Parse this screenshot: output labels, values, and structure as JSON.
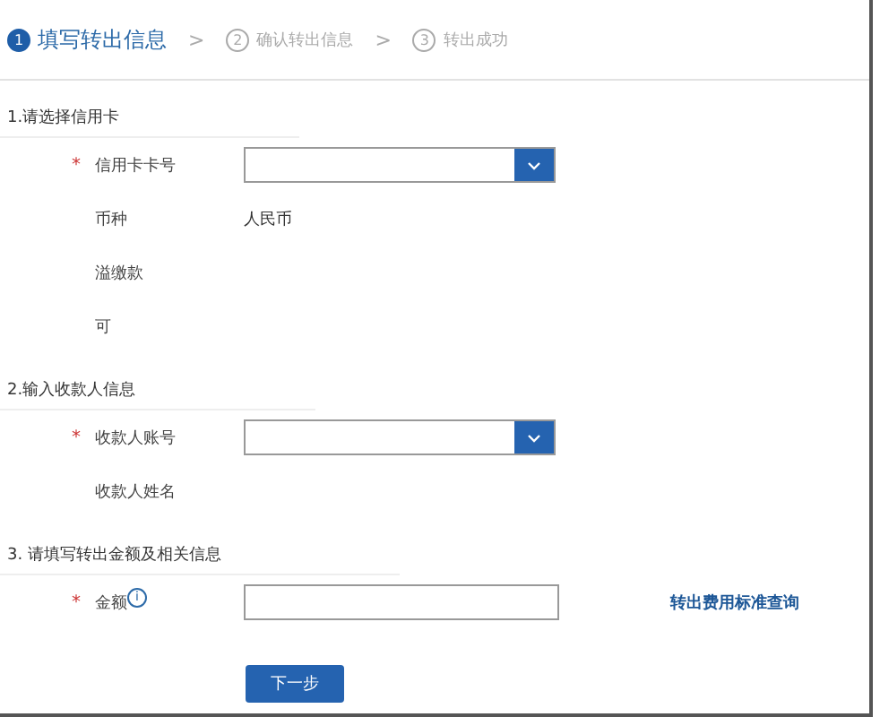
{
  "steps": [
    {
      "number": "1",
      "label": "填写转出信息",
      "selected": true
    },
    {
      "number": "2",
      "label": "确认转出信息",
      "selected": false
    },
    {
      "number": "3",
      "label": "转出成功",
      "selected": false
    }
  ],
  "step_separator": ">",
  "sections": [
    {
      "title": "1.请选择信用卡",
      "rows": [
        {
          "kind": "select",
          "label": "信用卡卡号",
          "required": true
        },
        {
          "kind": "text",
          "label": "币种",
          "required": false,
          "value": "人民币"
        },
        {
          "kind": "text",
          "label": "溢缴款",
          "required": false
        },
        {
          "kind": "text",
          "label": "可",
          "required": false
        }
      ]
    },
    {
      "title": "2.输入收款人信息",
      "rows": [
        {
          "kind": "select",
          "label": "收款人账号",
          "required": true
        },
        {
          "kind": "text",
          "label": "收款人姓名",
          "required": false
        }
      ]
    },
    {
      "title": "3. 请填写转出金额及相关信息",
      "rows": [
        {
          "kind": "input",
          "label": "金额",
          "required": true,
          "info": "i",
          "link": "转出费用标准查询"
        }
      ]
    }
  ],
  "required_mark": "*",
  "next_button": "下一步"
}
